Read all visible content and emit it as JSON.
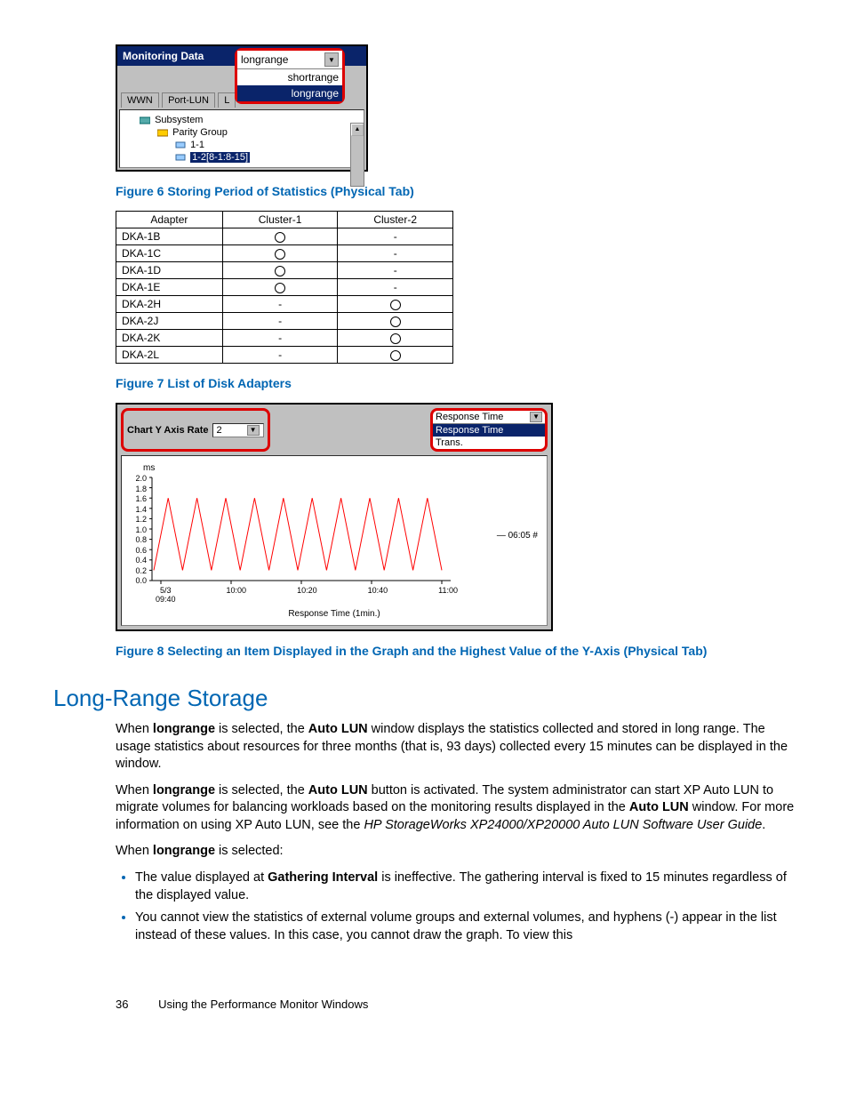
{
  "fig6": {
    "caption": "Figure 6 Storing Period of Statistics (Physical Tab)",
    "titlebar": "Monitoring Data",
    "dropdown_value": "longrange",
    "dropdown_options": [
      "shortrange",
      "longrange"
    ],
    "tabs": [
      "WWN",
      "Port-LUN"
    ],
    "tree": {
      "root": "Subsystem",
      "group": "Parity Group",
      "leaf1": "1-1",
      "leaf2_highlight": "1-2[8-1:8-15]"
    }
  },
  "fig7": {
    "caption": "Figure 7 List of Disk Adapters",
    "headers": [
      "Adapter",
      "Cluster-1",
      "Cluster-2"
    ],
    "rows": [
      {
        "adapter": "DKA-1B",
        "c1": "O",
        "c2": "-"
      },
      {
        "adapter": "DKA-1C",
        "c1": "O",
        "c2": "-"
      },
      {
        "adapter": "DKA-1D",
        "c1": "O",
        "c2": "-"
      },
      {
        "adapter": "DKA-1E",
        "c1": "O",
        "c2": "-"
      },
      {
        "adapter": "DKA-2H",
        "c1": "-",
        "c2": "O"
      },
      {
        "adapter": "DKA-2J",
        "c1": "-",
        "c2": "O"
      },
      {
        "adapter": "DKA-2K",
        "c1": "-",
        "c2": "O"
      },
      {
        "adapter": "DKA-2L",
        "c1": "-",
        "c2": "O"
      }
    ]
  },
  "fig8": {
    "caption": "Figure 8 Selecting an Item Displayed in the Graph and the Highest Value of the Y-Axis (Physical Tab)",
    "yaxis_label": "Chart Y Axis Rate",
    "yaxis_value": "2",
    "metric_dropdown_value": "Response Time",
    "metric_dropdown_options": [
      "Response Time",
      "Trans."
    ],
    "chart_title": "Response Time (1min.)",
    "legend_label": "06:05 #",
    "y_unit": "ms"
  },
  "chart_data": {
    "type": "line",
    "title": "Response Time (1min.)",
    "xlabel": "",
    "ylabel": "ms",
    "ylim": [
      0.0,
      2.0
    ],
    "y_ticks": [
      "2.0",
      "1.8",
      "1.6",
      "1.4",
      "1.2",
      "1.0",
      "0.8",
      "0.6",
      "0.4",
      "0.2",
      "0.0"
    ],
    "x_ticks": [
      "5/3 09:40",
      "10:00",
      "10:20",
      "10:40",
      "11:00"
    ],
    "series": [
      {
        "name": "06:05 #",
        "color": "#ff0000",
        "values": [
          0.2,
          1.6,
          0.2,
          1.6,
          0.2,
          1.6,
          0.2,
          1.6,
          0.2,
          1.6,
          0.2,
          1.6,
          0.2,
          1.6,
          0.2,
          1.6,
          0.2,
          1.6,
          0.2,
          1.6,
          0.2
        ]
      }
    ]
  },
  "section": {
    "heading": "Long-Range Storage",
    "para1_pre": "When ",
    "para1_b1": "longrange",
    "para1_mid1": " is selected, the ",
    "para1_b2": "Auto LUN",
    "para1_post": " window displays the statistics collected and stored in long range. The usage statistics about resources for three months (that is, 93 days) collected every 15 minutes can be displayed in the window.",
    "para2_pre": "When ",
    "para2_b1": "longrange",
    "para2_mid1": " is selected, the ",
    "para2_b2": "Auto LUN",
    "para2_mid2": " button is activated. The system administrator can start XP Auto LUN to migrate volumes for balancing workloads based on the monitoring results displayed in the ",
    "para2_b3": "Auto LUN",
    "para2_mid3": " window. For more information on using XP Auto LUN, see the ",
    "para2_i": "HP StorageWorks XP24000/XP20000 Auto LUN Software User Guide",
    "para2_end": ".",
    "para3_pre": "When ",
    "para3_b": "longrange",
    "para3_post": " is selected:",
    "bullet1_pre": "The value displayed at ",
    "bullet1_b": "Gathering Interval",
    "bullet1_post": " is ineffective. The gathering interval is fixed to 15 minutes regardless of the displayed value.",
    "bullet2": "You cannot view the statistics of external volume groups and external volumes, and hyphens (-) appear in the list instead of these values. In this case, you cannot draw the graph. To view this"
  },
  "footer": {
    "page": "36",
    "text": "Using the Performance Monitor Windows"
  }
}
